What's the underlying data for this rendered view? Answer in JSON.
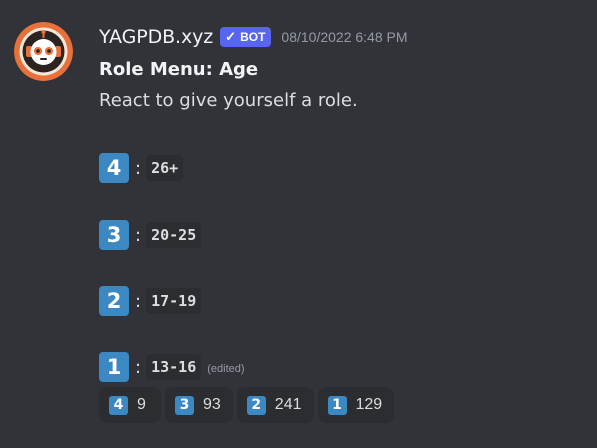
{
  "message": {
    "username": "YAGPDB.xyz",
    "bot_tag": "BOT",
    "bot_check": "✓",
    "timestamp": "08/10/2022 6:48 PM",
    "title": "Role Menu: Age",
    "subtitle": "React to give yourself a role.",
    "edited_label": "(edited)",
    "colon": ":"
  },
  "roles": [
    {
      "key": "4",
      "label": "26+"
    },
    {
      "key": "3",
      "label": "20-25"
    },
    {
      "key": "2",
      "label": "17-19"
    },
    {
      "key": "1",
      "label": "13-16"
    }
  ],
  "reactions": [
    {
      "key": "4",
      "count": "9"
    },
    {
      "key": "3",
      "count": "93"
    },
    {
      "key": "2",
      "count": "241"
    },
    {
      "key": "1",
      "count": "129"
    }
  ],
  "colors": {
    "background": "#313338",
    "bot_tag": "#5865f2",
    "keycap": "#3b88c3",
    "code_bg": "#2b2d31",
    "avatar_ring": "#e8703a"
  },
  "icons": {
    "avatar": "yagpdb-robot-avatar",
    "keycap": "keycap-digit-emoji"
  }
}
